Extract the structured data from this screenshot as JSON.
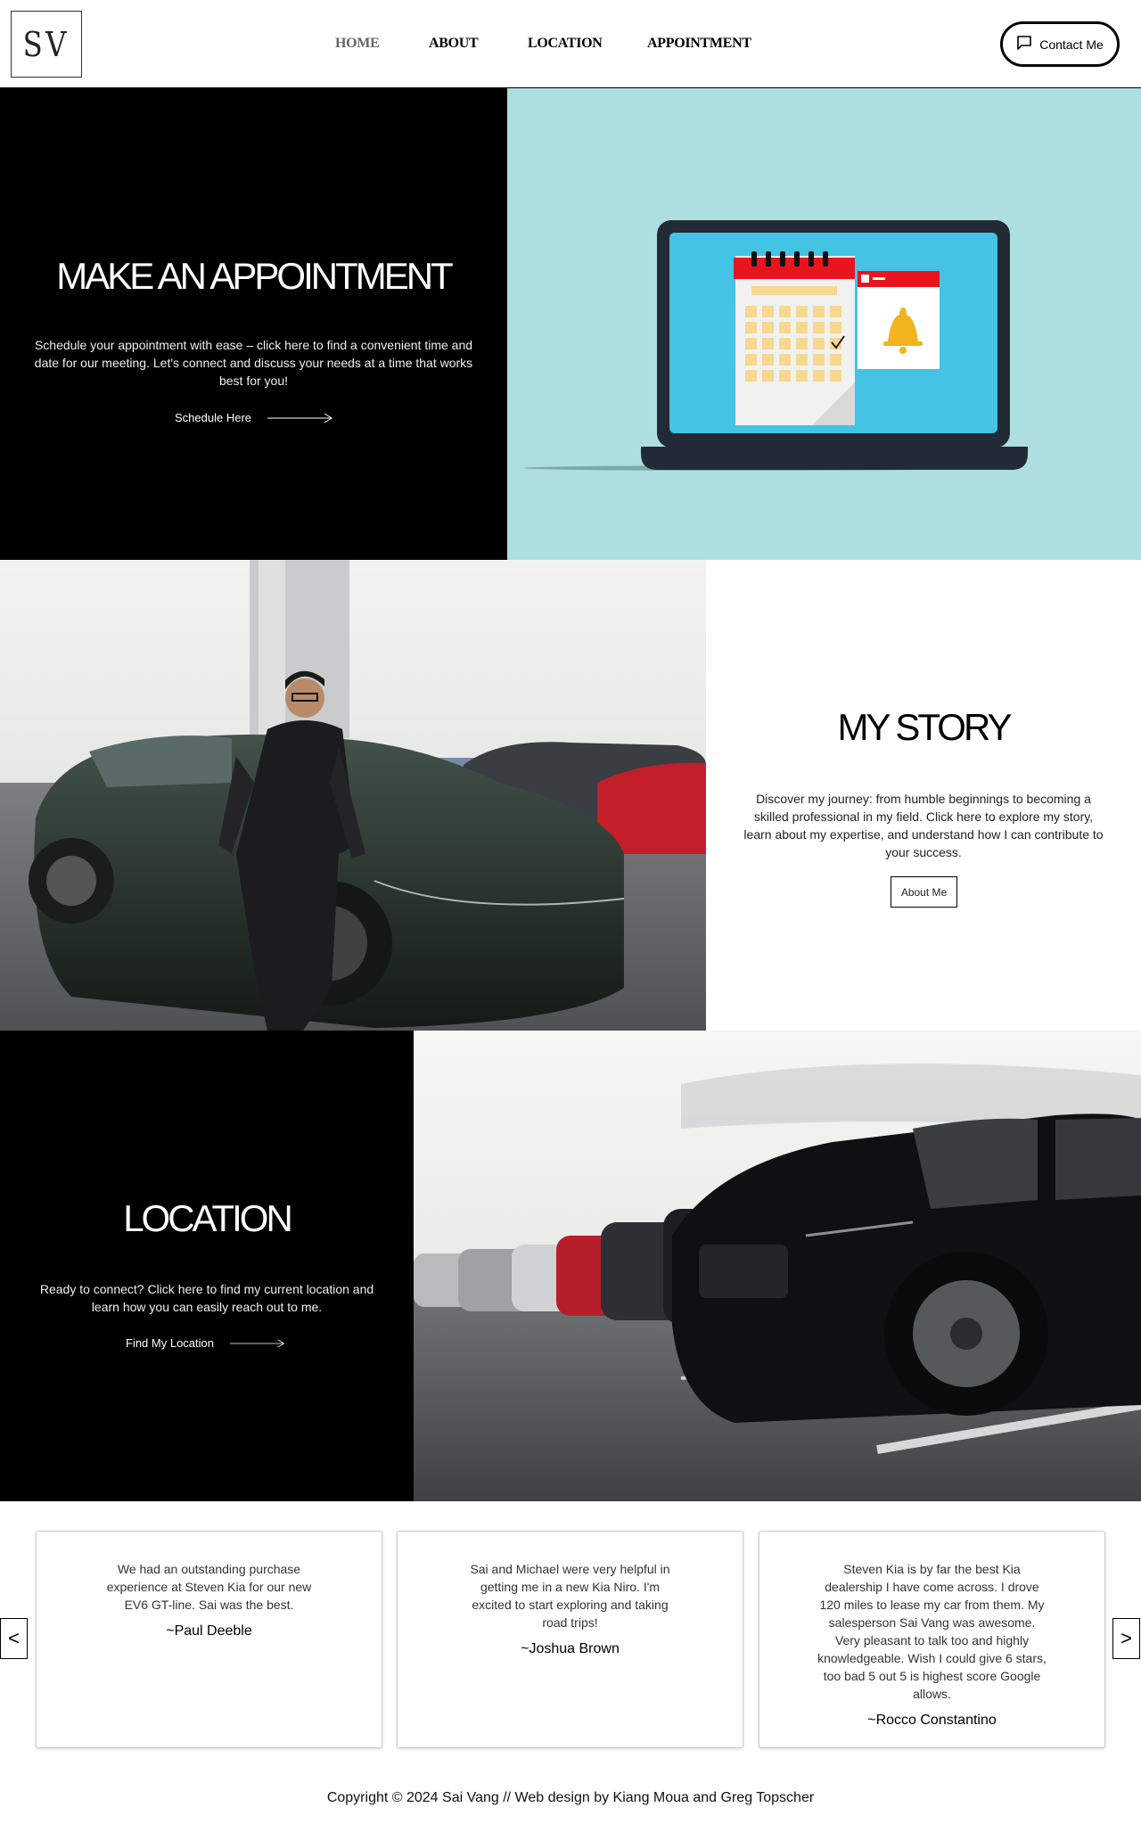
{
  "header": {
    "logo": "SV",
    "nav": [
      "HOME",
      "ABOUT",
      "LOCATION",
      "APPOINTMENT"
    ],
    "contact_label": "Contact Me"
  },
  "appointment": {
    "title": "MAKE AN APPOINTMENT",
    "text": "Schedule your appointment with ease – click here to find a convenient time and date for our meeting. Let's connect and discuss your needs at a time that works best for you!",
    "link_label": "Schedule Here"
  },
  "story": {
    "title": "MY STORY",
    "text": "Discover my journey: from humble beginnings to becoming a skilled professional in my field. Click here to explore my story, learn about my expertise, and understand how I can contribute to your success.",
    "button_label": "About Me"
  },
  "location": {
    "title": "LOCATION",
    "text": "Ready to connect? Click here to find my current location and learn how you can easily reach out to me.",
    "link_label": "Find My Location"
  },
  "testimonials": {
    "prev_label": "<",
    "next_label": ">",
    "items": [
      {
        "quote": "We had an outstanding purchase experience at Steven Kia for our new EV6 GT-line. Sai was the best.",
        "author": "~Paul Deeble"
      },
      {
        "quote": "Sai and Michael were very helpful in getting me in a new Kia Niro. I'm excited to start exploring and taking road trips!",
        "author": "~Joshua Brown"
      },
      {
        "quote": "Steven Kia is by far the best Kia dealership I have come across. I drove 120 miles to lease my car from them. My salesperson Sai Vang was awesome. Very pleasant to talk too and highly knowledgeable. Wish I could give 6 stars, too bad 5 out 5 is highest score Google allows.",
        "author": "~Rocco Constantino"
      }
    ]
  },
  "footer": {
    "text": "Copyright © 2024 Sai Vang // Web design by Kiang Moua and Greg Topscher"
  },
  "colors": {
    "hero_bg": "#aedfe0",
    "dark_bg": "#000000",
    "screen": "#45c3e4",
    "calendar_red": "#e9141d",
    "bell": "#f2b321"
  }
}
